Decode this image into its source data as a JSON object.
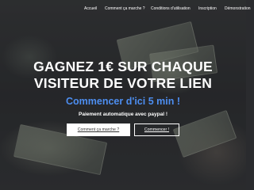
{
  "nav": {
    "items": [
      {
        "label": "Accueil"
      },
      {
        "label": "Comment ça marche ?"
      },
      {
        "label": "Conditions d'utilisation"
      },
      {
        "label": "Inscription"
      },
      {
        "label": "Démonstration"
      }
    ]
  },
  "hero": {
    "title_line1": "GAGNEZ 1€ SUR CHAQUE",
    "title_line2": "VISITEUR DE VOTRE LIEN",
    "subtitle": "Commencer d'ici 5 min !",
    "tagline": "Paiement automatique avec paypal !",
    "primary_button": "Comment ça marche ?",
    "secondary_button": "Commencer !"
  },
  "colors": {
    "accent": "#4d8ef0",
    "background": "#2f3133"
  }
}
